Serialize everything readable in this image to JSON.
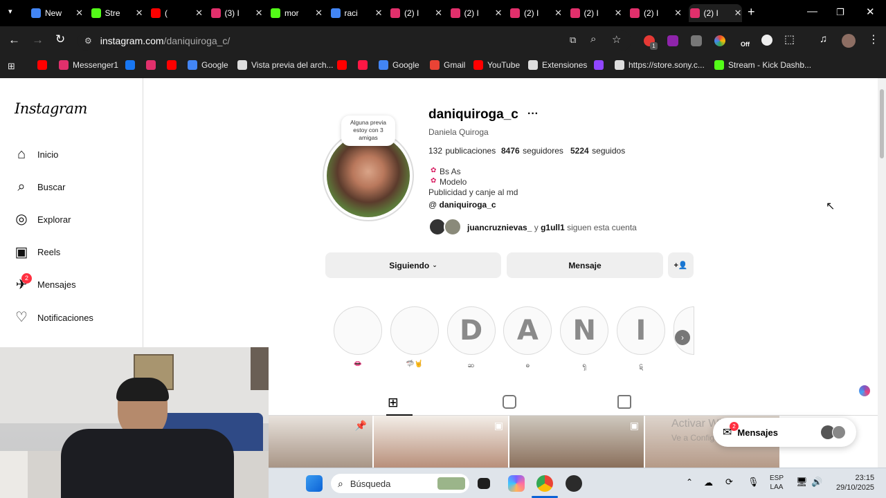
{
  "browser": {
    "tabs": [
      {
        "title": "New",
        "favicon_color": "#4285f4"
      },
      {
        "title": "Stre",
        "favicon_color": "#53fc18"
      },
      {
        "title": "(",
        "favicon_color": "#ff0000"
      },
      {
        "title": "(3) I",
        "favicon_color": "#e1306c"
      },
      {
        "title": "mor",
        "favicon_color": "#53fc18"
      },
      {
        "title": "raci",
        "favicon_color": "#4285f4"
      },
      {
        "title": "(2) I",
        "favicon_color": "#e1306c"
      },
      {
        "title": "(2) I",
        "favicon_color": "#e1306c"
      },
      {
        "title": "(2) I",
        "favicon_color": "#e1306c"
      },
      {
        "title": "(2) I",
        "favicon_color": "#e1306c"
      },
      {
        "title": "(2) I",
        "favicon_color": "#e1306c"
      },
      {
        "title": "(2) I",
        "favicon_color": "#e1306c"
      }
    ],
    "new_tab": "+",
    "url_host": "instagram.com",
    "url_path": "/daniquiroga_c/",
    "ext_off_label": "Off",
    "ext_badge": "1",
    "bookmarks": [
      {
        "label": "",
        "color": "#ff0000"
      },
      {
        "label": "Messenger1",
        "color": "#e1306c"
      },
      {
        "label": "",
        "color": "#1877f2"
      },
      {
        "label": "",
        "color": "#e1306c"
      },
      {
        "label": "",
        "color": "#ff0000"
      },
      {
        "label": "Google",
        "color": "#4285f4"
      },
      {
        "label": "Vista previa del arch...",
        "color": "#dddddd"
      },
      {
        "label": "",
        "color": "#ff0000"
      },
      {
        "label": "",
        "color": "#ff1744"
      },
      {
        "label": "Google",
        "color": "#4285f4"
      },
      {
        "label": "Gmail",
        "color": "#ea4335"
      },
      {
        "label": "YouTube",
        "color": "#ff0000"
      },
      {
        "label": "Extensiones",
        "color": "#dddddd"
      },
      {
        "label": "",
        "color": "#9146ff"
      },
      {
        "label": "https://store.sony.c...",
        "color": "#dddddd"
      },
      {
        "label": "Stream - Kick Dashb...",
        "color": "#53fc18"
      }
    ]
  },
  "sidebar": {
    "logo": "Instagram",
    "items": [
      {
        "label": "Inicio",
        "icon": "home-icon"
      },
      {
        "label": "Buscar",
        "icon": "search-icon"
      },
      {
        "label": "Explorar",
        "icon": "compass-icon"
      },
      {
        "label": "Reels",
        "icon": "reels-icon"
      },
      {
        "label": "Mensajes",
        "icon": "messenger-icon",
        "badge": "2"
      },
      {
        "label": "Notificaciones",
        "icon": "heart-icon"
      }
    ]
  },
  "profile": {
    "note": "Alguna previa estoy con 3 amigas",
    "username": "daniquiroga_c",
    "more": "···",
    "full_name": "Daniela Quiroga",
    "posts_count": "132",
    "posts_label": "publicaciones",
    "followers_count": "8476",
    "followers_label": "seguidores",
    "following_count": "5224",
    "following_label": "seguidos",
    "bio_lines": [
      "Bs As",
      "Modelo",
      "Publicidad y canje al md"
    ],
    "threads_handle": "daniquiroga_c",
    "followed_by_1": "juancruznievas_",
    "followed_by_and": "y",
    "followed_by_2": "g1ull1",
    "followed_by_suffix": "siguen esta cuenta",
    "following_button": "Siguiendo",
    "message_button": "Mensaje",
    "highlights": [
      {
        "glyph": "",
        "label": "👄"
      },
      {
        "glyph": "",
        "label": "🦈🤘"
      },
      {
        "glyph": "D",
        "label": "ဆ"
      },
      {
        "glyph": "A",
        "label": "ဓ"
      },
      {
        "glyph": "N",
        "label": "ၡ"
      },
      {
        "glyph": "I",
        "label": "ဋ"
      },
      {
        "glyph": "",
        "label": ""
      }
    ]
  },
  "messages_popup": {
    "label": "Mensajes",
    "badge": "2"
  },
  "watermark": {
    "line1": "Activar Windows",
    "line2": "Ve a Configuración para activar Windows."
  },
  "taskbar": {
    "search_placeholder": "Búsqueda",
    "lang1": "ESP",
    "lang2": "LAA",
    "time": "23:15",
    "date": "29/10/2025"
  },
  "colors": {
    "instagram_badge": "#ff3040",
    "bar_dark": "#1f1f1f"
  }
}
